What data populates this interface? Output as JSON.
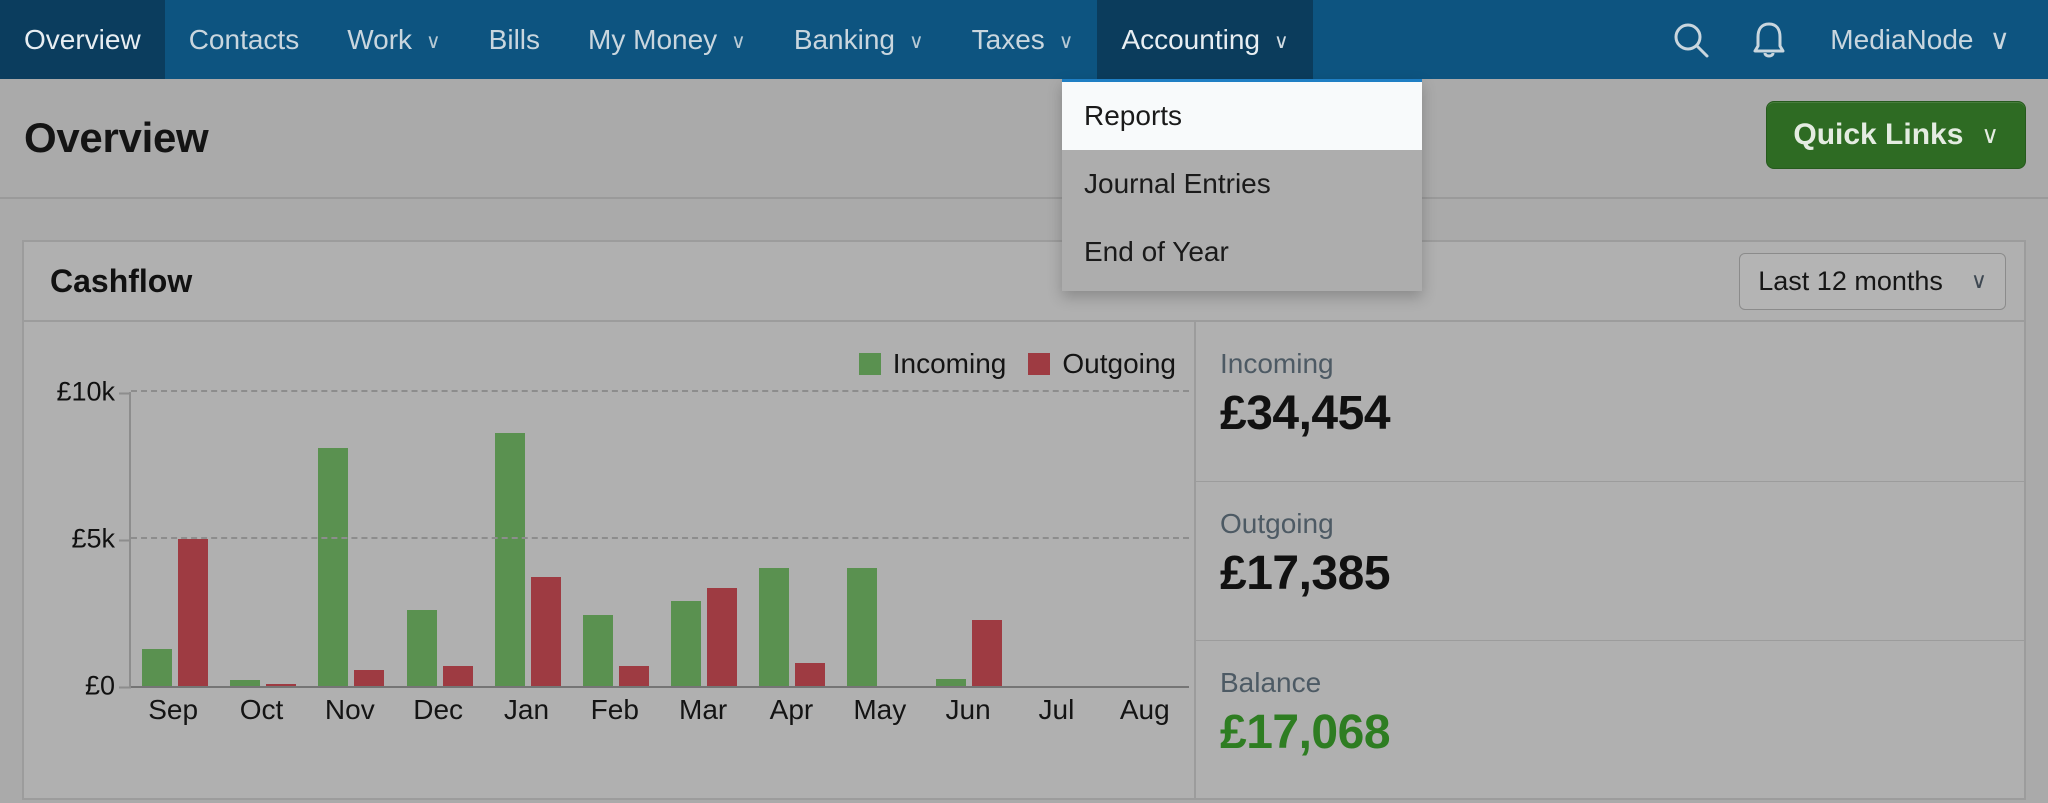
{
  "nav": {
    "items": [
      {
        "label": "Overview",
        "caret": false,
        "state": "active"
      },
      {
        "label": "Contacts",
        "caret": false,
        "state": ""
      },
      {
        "label": "Work",
        "caret": true,
        "state": ""
      },
      {
        "label": "Bills",
        "caret": false,
        "state": ""
      },
      {
        "label": "My Money",
        "caret": true,
        "state": ""
      },
      {
        "label": "Banking",
        "caret": true,
        "state": ""
      },
      {
        "label": "Taxes",
        "caret": true,
        "state": ""
      },
      {
        "label": "Accounting",
        "caret": true,
        "state": "open"
      }
    ],
    "caret_glyph": "∨",
    "user_label": "MediaNode",
    "search_icon": "search-icon",
    "bell_icon": "bell-icon"
  },
  "dropdown": {
    "open_for": "Accounting",
    "items": [
      {
        "label": "Reports",
        "highlighted": true
      },
      {
        "label": "Journal Entries",
        "highlighted": false
      },
      {
        "label": "End of Year",
        "highlighted": false
      }
    ]
  },
  "header": {
    "title": "Overview",
    "quick_links_label": "Quick Links",
    "quick_links_caret": "∨",
    "quick_links_color": "#2e6b23"
  },
  "card": {
    "title": "Cashflow",
    "range_value": "Last 12 months",
    "range_caret": "∨"
  },
  "stats": [
    {
      "label": "Incoming",
      "value": "£34,454",
      "color": "#111111"
    },
    {
      "label": "Outgoing",
      "value": "£17,385",
      "color": "#111111"
    },
    {
      "label": "Balance",
      "value": "£17,068",
      "color": "#2e7d22"
    }
  ],
  "chart_data": {
    "type": "bar",
    "title": "Cashflow",
    "xlabel": "",
    "ylabel": "",
    "ylim": [
      0,
      10000
    ],
    "yticks": [
      0,
      5000,
      10000
    ],
    "ytick_labels": [
      "£0",
      "£5k",
      "£10k"
    ],
    "grid": true,
    "legend_position": "top-right",
    "categories": [
      "Sep",
      "Oct",
      "Nov",
      "Dec",
      "Jan",
      "Feb",
      "Mar",
      "Apr",
      "May",
      "Jun",
      "Jul",
      "Aug"
    ],
    "series": [
      {
        "name": "Incoming",
        "color": "#5a9150",
        "values": [
          1250,
          200,
          8100,
          2600,
          8600,
          2400,
          2900,
          4000,
          4000,
          250,
          0,
          0
        ]
      },
      {
        "name": "Outgoing",
        "color": "#9e3b42",
        "values": [
          5000,
          70,
          530,
          670,
          3700,
          670,
          3350,
          780,
          0,
          2250,
          0,
          0
        ]
      }
    ]
  }
}
